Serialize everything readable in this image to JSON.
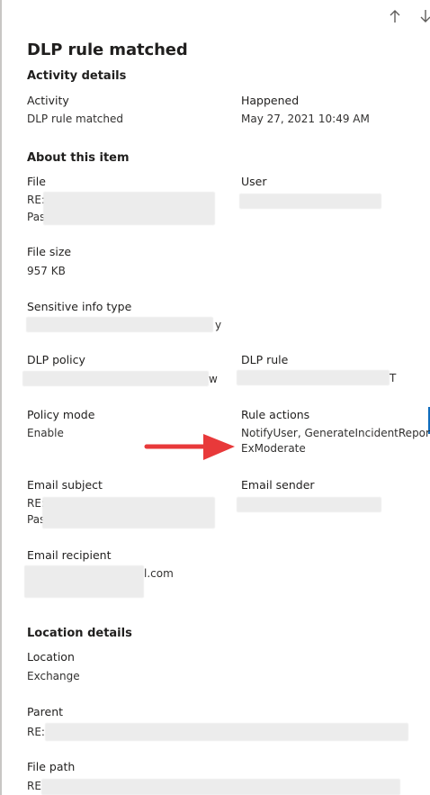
{
  "panel": {
    "title": "DLP rule matched",
    "nav": {
      "up_icon": "arrow-up-icon",
      "down_icon": "arrow-down-icon"
    }
  },
  "activity_details": {
    "heading": "Activity details",
    "activity_label": "Activity",
    "activity_value": "DLP rule matched",
    "happened_label": "Happened",
    "happened_value": "May 27, 2021 10:49 AM"
  },
  "about_item": {
    "heading": "About this item",
    "file_label": "File",
    "file_value_line1": "RE:",
    "file_value_line2": "Pas",
    "user_label": "User",
    "file_size_label": "File size",
    "file_size_value": "957 KB",
    "sensitive_label": "Sensitive info type",
    "sensitive_tail": "y",
    "dlp_policy_label": "DLP policy",
    "dlp_policy_tail": "w",
    "dlp_rule_label": "DLP rule",
    "dlp_rule_tail": "T",
    "policy_mode_label": "Policy mode",
    "policy_mode_value": "Enable",
    "rule_actions_label": "Rule actions",
    "rule_actions_line1": "NotifyUser, GenerateIncidentReport,",
    "rule_actions_line2": "ExModerate",
    "email_subject_label": "Email subject",
    "email_subject_line1": "RE:",
    "email_subject_line2": "Pas",
    "email_sender_label": "Email sender",
    "email_recipient_label": "Email recipient",
    "email_recipient_tail": "l.com"
  },
  "location_details": {
    "heading": "Location details",
    "location_label": "Location",
    "location_value": "Exchange",
    "parent_label": "Parent",
    "parent_value": "RE:",
    "file_path_label": "File path",
    "file_path_value": "RE:"
  },
  "colors": {
    "arrow": "#e8393a",
    "accent": "#0f6cbd",
    "redaction": "#ececec"
  }
}
